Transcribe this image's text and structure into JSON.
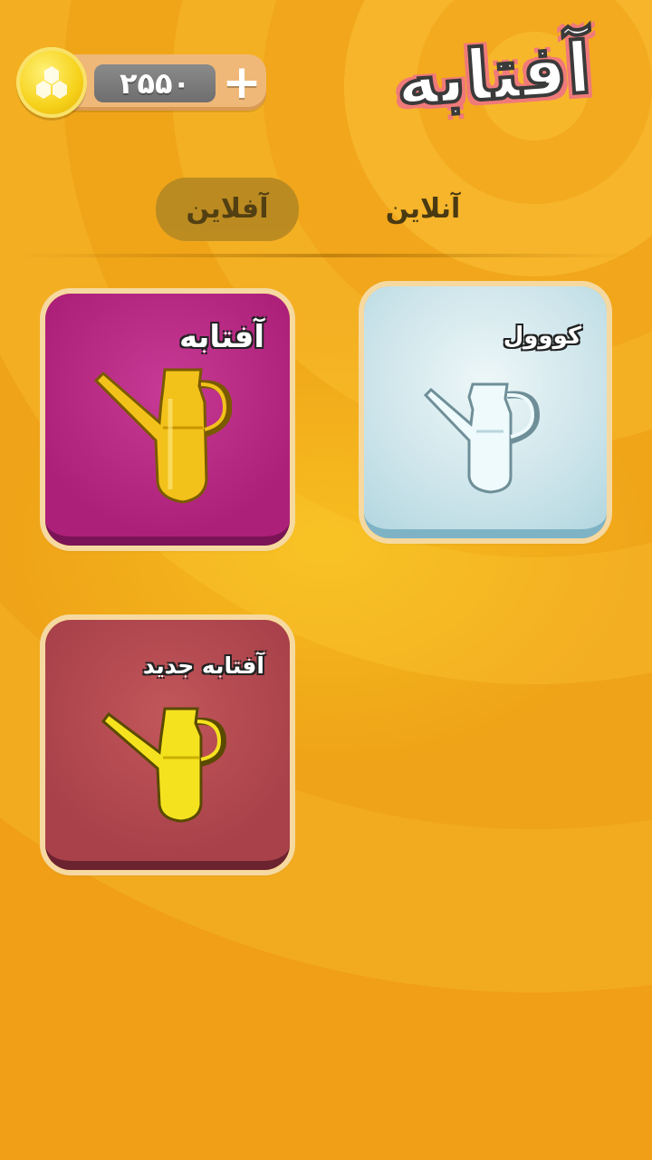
{
  "app": {
    "title": "آفتابه"
  },
  "coins": {
    "value": "۲۵۵۰",
    "add_symbol": "+",
    "coin_icon": "honeycomb-coin-icon"
  },
  "tabs": [
    {
      "label": "آفلاین",
      "selected": true
    },
    {
      "label": "آنلاین",
      "selected": false
    }
  ],
  "items": [
    {
      "label": "کووول",
      "icon": "ewer-icon",
      "color": "#c6e1e8"
    },
    {
      "label": "آفتابه",
      "icon": "ewer-icon",
      "color": "#ad2079"
    },
    {
      "label": "آفتابه جدید",
      "icon": "ewer-icon",
      "color": "#a8414a"
    }
  ],
  "colors": {
    "background": "#f3a818",
    "ewer_gold": "#f2c21b",
    "ewer_yellow": "#f5e21f",
    "ewer_ice": "#e8f6f8"
  }
}
